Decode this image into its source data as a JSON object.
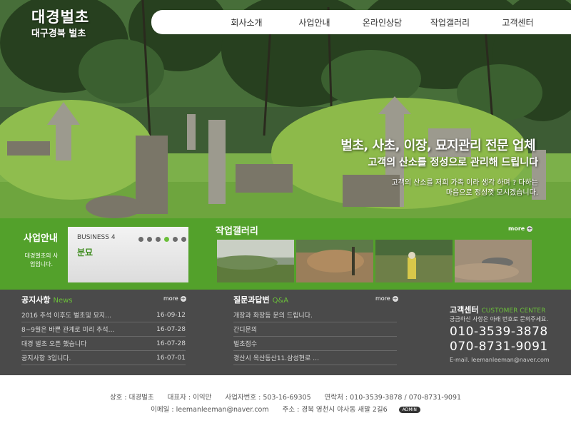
{
  "header": {
    "logo_title": "대경벌초",
    "logo_subtitle": "대구경북 벌초",
    "nav": [
      "회사소개",
      "사업안내",
      "온라인상담",
      "작업갤러리",
      "고객센터"
    ]
  },
  "hero": {
    "title": "벌초, 사초, 이장, 묘지관리 전문 업체",
    "subtitle": "고객의 산소를 정성으로 관리해 드립니다",
    "desc_line1": "고객의 산소를 저희 가족 이라 생각 하며 ? 다하는",
    "desc_line2": "마음으로 정성껏 모시겠습니다."
  },
  "business": {
    "title": "사업안내",
    "desc": "대경벌초의 사업입니다.",
    "slide_number": "BUSINESS 4",
    "slide_name": "분묘",
    "slide_count": 6,
    "active_slide": 4
  },
  "gallery": {
    "title": "작업갤러리",
    "more": "more"
  },
  "notice": {
    "title": "공지사항",
    "title_en": "News",
    "more": "more",
    "items": [
      {
        "text": "2016 추석 이후도 벌초및 묘지…",
        "date": "16-09-12"
      },
      {
        "text": "8~9월은 바쁜 관계로 미리 추석…",
        "date": "16-07-28"
      },
      {
        "text": "대경 벌초 오픈 했습니다",
        "date": "16-07-28"
      },
      {
        "text": "공지사항 3입니다.",
        "date": "16-07-01"
      }
    ]
  },
  "qna": {
    "title": "질문과답변",
    "title_en": "Q&A",
    "more": "more",
    "items": [
      "개장과 화장등 문의 드립니다.",
      "간디문의",
      "벌초접수",
      "경산시 옥산동산11.삼성현로 …"
    ]
  },
  "customer": {
    "title": "고객센터",
    "title_en": "CUSTOMER CENTER",
    "desc": "궁금하신 사항은 아래 번호로 문의주세요.",
    "phone1": "010-3539-3878",
    "phone2": "070-8731-9091",
    "email": "E-mail. leemanleeman@naver.com"
  },
  "footer": {
    "company": "상호 : 대경벌초",
    "ceo": "대표자 : 이익만",
    "biz_no": "사업자번호 : 503-16-69305",
    "contact": "연락처 : 010-3539-3878 / 070-8731-9091",
    "email": "이메일 : leemanleeman@naver.com",
    "address": "주소 : 경북 영천시 야사동 새말 2길6",
    "admin": "ADMIN"
  },
  "colors": {
    "brand_green": "#53a12b",
    "dark_gray": "#4a4a4a",
    "accent_green": "#6bbf3a"
  }
}
